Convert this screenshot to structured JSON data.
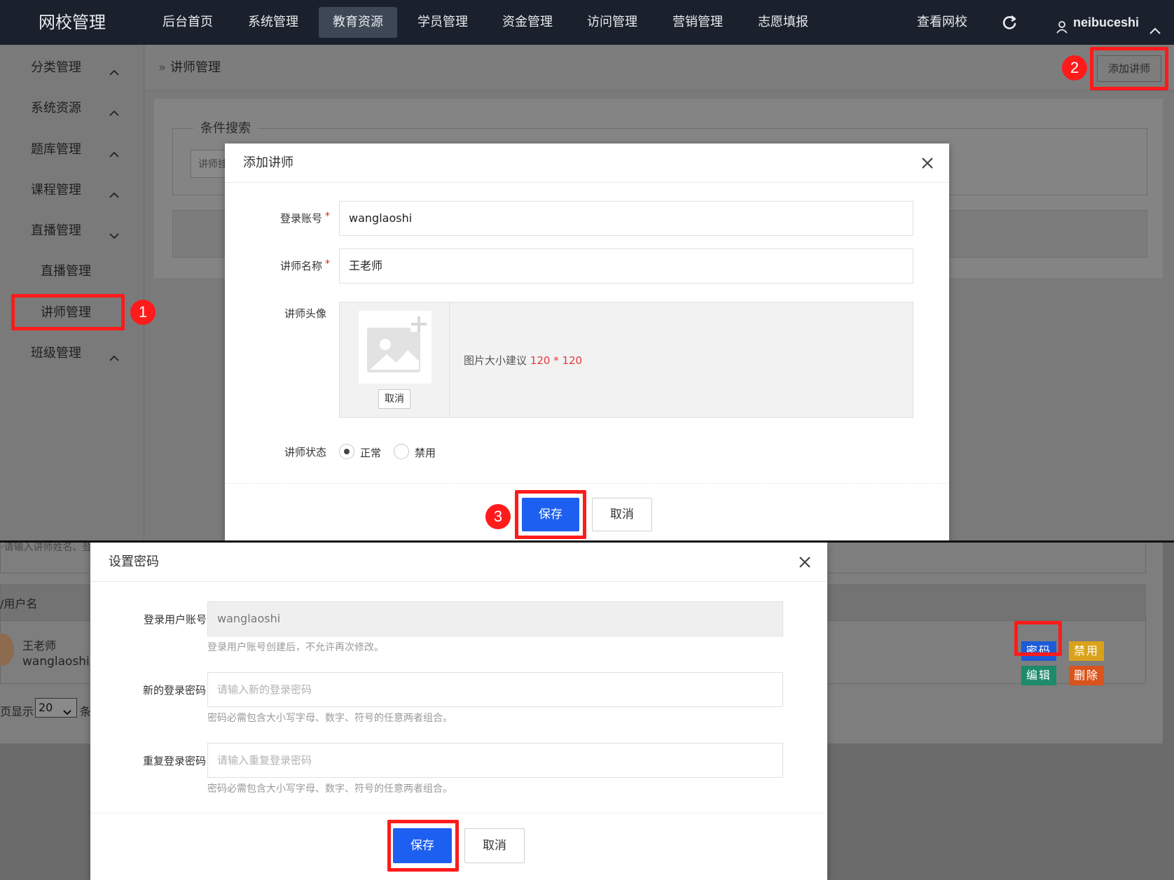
{
  "topbar": {
    "logo": "网校管理",
    "nav": [
      {
        "label": "后台首页",
        "active": false
      },
      {
        "label": "系统管理",
        "active": false
      },
      {
        "label": "教育资源",
        "active": true
      },
      {
        "label": "学员管理",
        "active": false
      },
      {
        "label": "资金管理",
        "active": false
      },
      {
        "label": "访问管理",
        "active": false
      },
      {
        "label": "营销管理",
        "active": false
      },
      {
        "label": "志愿填报",
        "active": false
      }
    ],
    "view_school": "查看网校",
    "username": "neibuceshi"
  },
  "sidebar": {
    "items": [
      {
        "label": "分类管理",
        "expanded": false
      },
      {
        "label": "系统资源",
        "expanded": false
      },
      {
        "label": "题库管理",
        "expanded": false
      },
      {
        "label": "课程管理",
        "expanded": false
      },
      {
        "label": "直播管理",
        "expanded": true
      },
      {
        "label": "班级管理",
        "expanded": false
      }
    ],
    "subitems": [
      {
        "label": "直播管理"
      },
      {
        "label": "讲师管理"
      }
    ]
  },
  "breadcrumb": {
    "current": "讲师管理"
  },
  "toolbar": {
    "add_teacher_label": "添加讲师"
  },
  "search_panel": {
    "legend": "条件搜索",
    "input_text": "讲师挂"
  },
  "badges": {
    "one": "1",
    "two": "2",
    "three": "3"
  },
  "add_teacher_modal": {
    "title": "添加讲师",
    "login_account_label": "登录账号",
    "login_account_value": "wanglaoshi",
    "teacher_name_label": "讲师名称",
    "teacher_name_value": "王老师",
    "avatar_label": "讲师头像",
    "avatar_cancel": "取消",
    "avatar_hint": "图片大小建议",
    "avatar_size": "120 * 120",
    "status_label": "讲师状态",
    "status_options": [
      "正常",
      "禁用"
    ],
    "status_selected": "正常",
    "save_label": "保存",
    "cancel_label": "取消"
  },
  "background_list": {
    "search_text": "·请输入讲师姓名、登",
    "col_user": "/用户名",
    "teacher_name": "王老师",
    "teacher_account": "wanglaoshi",
    "page_size_prefix": "页显示",
    "page_size_value": "20",
    "page_size_suffix": "条",
    "actions": {
      "password": "密码",
      "disable": "禁用",
      "edit": "编辑",
      "delete": "删除"
    },
    "action_colors": {
      "password": "#1d5bd8",
      "disable": "#d9a21a",
      "edit": "#1d8a6a",
      "delete": "#d9541d"
    }
  },
  "password_modal": {
    "title": "设置密码",
    "account_label": "登录用户账号",
    "account_value": "wanglaoshi",
    "account_hint": "登录用户账号创建后，不允许再次修改。",
    "new_pwd_label": "新的登录密码",
    "new_pwd_placeholder": "请输入新的登录密码",
    "new_pwd_hint": "密码必需包含大小写字母、数字、符号的任意两者组合。",
    "repeat_pwd_label": "重复登录密码",
    "repeat_pwd_placeholder": "请输入重复登录密码",
    "repeat_pwd_hint": "密码必需包含大小写字母、数字、符号的任意两者组合。",
    "save_label": "保存",
    "cancel_label": "取消"
  },
  "colors": {
    "primary": "#1d5ff0",
    "highlight": "#ff1b1b",
    "topbar": "#1b212c"
  }
}
